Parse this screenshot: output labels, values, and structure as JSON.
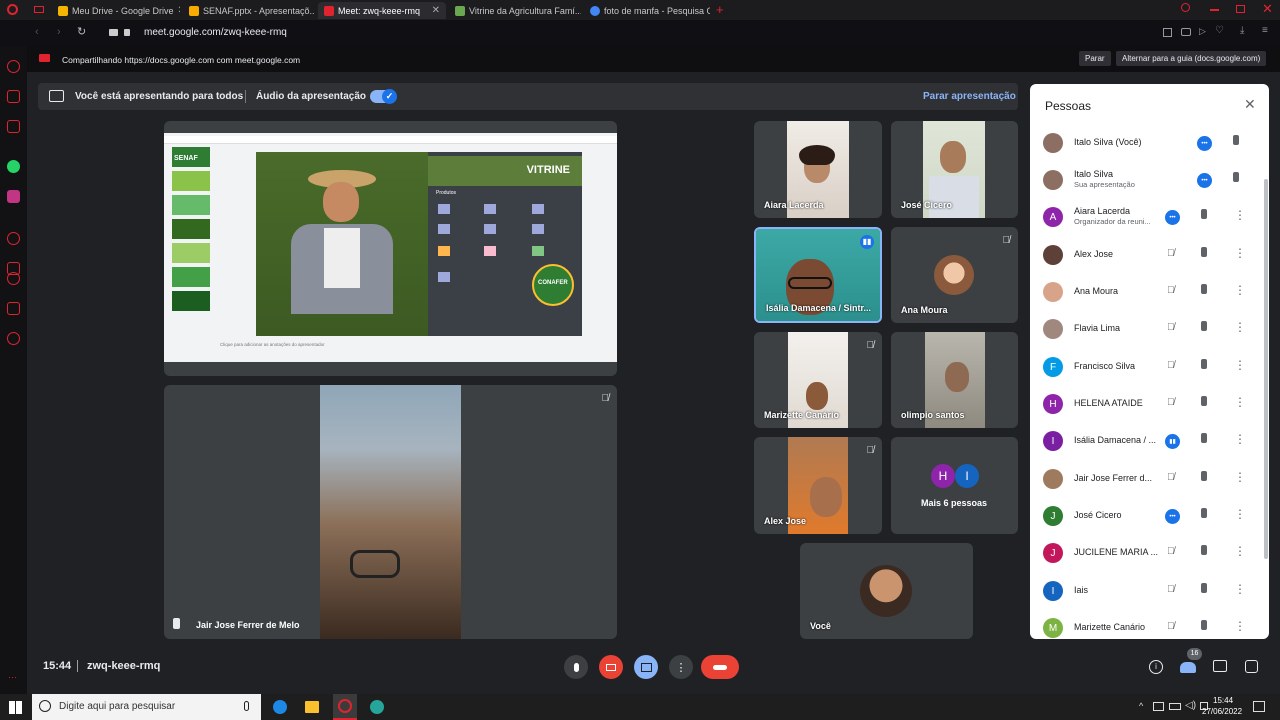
{
  "browser": {
    "tabs": [
      {
        "label": "Meu Drive - Google Drive",
        "color": "#f4b400"
      },
      {
        "label": "SENAF.pptx - Apresentaçõ...",
        "color": "#f9ab00"
      },
      {
        "label": "Meet: zwq-keee-rmq",
        "color": "#e0242f"
      },
      {
        "label": "Vitrine da Agricultura Famí...",
        "color": "#6aa84f"
      },
      {
        "label": "foto de manfa - Pesquisa G...",
        "color": "#4285f4"
      }
    ],
    "url": "meet.google.com/zwq-keee-rmq",
    "share_notice": "Compartilhando https://docs.google.com com meet.google.com",
    "stop_label": "Parar",
    "switch_label": "Alternar para a guia (docs.google.com)"
  },
  "presentation_bar": {
    "presenting_text": "Você está apresentando para todos",
    "audio_label": "Áudio da apresentação",
    "stop_presenting": "Parar apresentação"
  },
  "slide": {
    "logo_text": "SENAF",
    "vitrine_title": "VITRINE",
    "products_label": "Produtos",
    "seal_text": "CONAFER",
    "notes_placeholder": "Clique para adicionar as anotações do apresentador"
  },
  "tiles": [
    {
      "name": "Aiara Lacerda"
    },
    {
      "name": "José Cicero"
    },
    {
      "name": "Isália Damacena / Sintr..."
    },
    {
      "name": "Ana Moura"
    },
    {
      "name": "Marizette Canário"
    },
    {
      "name": "olimpio santos"
    },
    {
      "name": "Alex Jose"
    },
    {
      "name": "Mais 6 pessoas"
    },
    {
      "name": "Você"
    }
  ],
  "more_people_avatars": [
    "H",
    "I"
  ],
  "main_speaker": {
    "name": "Jair Jose Ferrer de Melo"
  },
  "people_panel": {
    "title": "Pessoas",
    "people": [
      {
        "name": "Italo Silva (Você)",
        "sub": "",
        "initial": "",
        "color": "#8d6e63"
      },
      {
        "name": "Italo Silva",
        "sub": "Sua apresentação",
        "initial": "",
        "color": "#8d6e63"
      },
      {
        "name": "Aiara Lacerda",
        "sub": "Organizador da reuni...",
        "initial": "A",
        "color": "#8e24aa"
      },
      {
        "name": "Alex Jose",
        "sub": "",
        "initial": "",
        "color": "#5d4037"
      },
      {
        "name": "Ana Moura",
        "sub": "",
        "initial": "",
        "color": "#d7a48a"
      },
      {
        "name": "Flavia Lima",
        "sub": "",
        "initial": "",
        "color": "#a1887f"
      },
      {
        "name": "Francisco Silva",
        "sub": "",
        "initial": "F",
        "color": "#039be5"
      },
      {
        "name": "HELENA ATAIDE",
        "sub": "",
        "initial": "H",
        "color": "#8e24aa"
      },
      {
        "name": "Isália Damacena / ...",
        "sub": "",
        "initial": "I",
        "color": "#7b1fa2"
      },
      {
        "name": "Jair Jose Ferrer d...",
        "sub": "",
        "initial": "",
        "color": "#9e7b5e"
      },
      {
        "name": "José Cicero",
        "sub": "",
        "initial": "J",
        "color": "#2e7d32"
      },
      {
        "name": "JUCILENE MARIA ...",
        "sub": "",
        "initial": "J",
        "color": "#c2185b"
      },
      {
        "name": "Iais",
        "sub": "",
        "initial": "I",
        "color": "#1565c0"
      },
      {
        "name": "Marizette Canário",
        "sub": "",
        "initial": "M",
        "color": "#7cb342"
      }
    ]
  },
  "footer": {
    "time": "15:44",
    "meeting_code": "zwq-keee-rmq",
    "participant_count": "16"
  },
  "taskbar": {
    "search_placeholder": "Digite aqui para pesquisar",
    "clock_time": "15:44",
    "clock_date": "27/06/2022"
  }
}
